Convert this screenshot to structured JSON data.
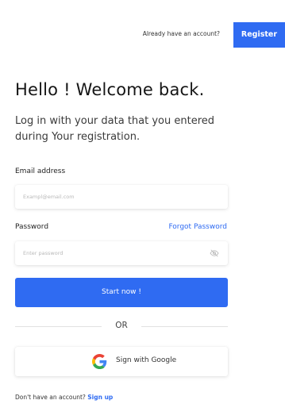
{
  "header": {
    "have_account_text": "Already have an account?",
    "register_label": "Register"
  },
  "login": {
    "title": "Hello ! Welcome back.",
    "subtitle": "Log in with your data that you entered during Your registration.",
    "email_label": "Email address",
    "email_placeholder": "Exampl@email.com",
    "password_label": "Password",
    "forgot_label": "Forgot Password",
    "password_placeholder": "Enter password",
    "submit_label": "Start now !",
    "or_text": "OR",
    "google_label": "Sign with Google"
  },
  "footer": {
    "no_account_text": "Don't have an account?",
    "signup_label": "Sign up"
  },
  "colors": {
    "accent": "#2f6bf2"
  },
  "icons": {
    "password_toggle": "eye-off-icon",
    "google": "google-icon"
  }
}
